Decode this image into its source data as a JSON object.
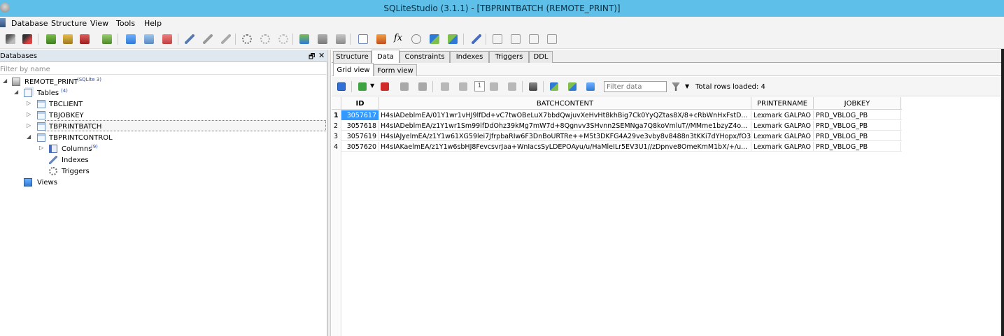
{
  "window": {
    "title": "SQLiteStudio (3.1.1) - [TBPRINTBATCH (REMOTE_PRINT)]"
  },
  "menu": [
    "Database",
    "Structure",
    "View",
    "Tools",
    "Help"
  ],
  "databases_panel": {
    "title": "Databases",
    "float_glyph": "🗗",
    "close_glyph": "✕",
    "filter_placeholder": "Filter by name",
    "database": {
      "name": "REMOTE_PRINT",
      "version": "(SQLite 3)"
    },
    "tables_group": {
      "label": "Tables",
      "count": "(4)"
    },
    "tables": [
      "TBCLIENT",
      "TBJOBKEY",
      "TBPRINTBATCH",
      "TBPRINTCONTROL"
    ],
    "columns_node": {
      "label": "Columns",
      "count": "(9)"
    },
    "indexes_label": "Indexes",
    "triggers_label": "Triggers",
    "views_label": "Views"
  },
  "tabs": [
    "Structure",
    "Data",
    "Constraints",
    "Indexes",
    "Triggers",
    "DDL"
  ],
  "active_tab": "Data",
  "subtabs": [
    "Grid view",
    "Form view"
  ],
  "grid_toolbar": {
    "page_number": "1",
    "filter_placeholder": "Filter data",
    "total_rows": "Total rows loaded: 4"
  },
  "grid": {
    "columns": [
      "ID",
      "BATCHCONTENT",
      "PRINTERNAME",
      "JOBKEY"
    ],
    "rows": [
      {
        "num": "1",
        "id": "3057617",
        "batch": "H4sIADeblmEA/01Y1wr1vHJ9lfDd+vC7twOBeLuX7bbdQwjuvXeHvHt8khBig7Ck0YyQZtas8X/8+cRbWnHxFstD...",
        "printer": "Lexmark GALPAO",
        "job": "PRD_VBLOG_PB"
      },
      {
        "num": "2",
        "id": "3057618",
        "batch": "H4sIADeblmEA/z1Y1wr1Sm99lfDdOhz39kMg7mW7d+8Qgnvv3SHvnn2SEMNga7Q8koVmluT//MMme1bzyZ4o...",
        "printer": "Lexmark GALPAO",
        "job": "PRD_VBLOG_PB"
      },
      {
        "num": "3",
        "id": "3057619",
        "batch": "H4sIAJyelmEA/z1Y1w61XG59lei7JfrpbaRIw6F3DnBoURTRe++M5t3DKFG4A29ve3vby8v8488n3tKKi7dYHopx/fO3...",
        "printer": "Lexmark GALPAO",
        "job": "PRD_VBLOG_PB"
      },
      {
        "num": "4",
        "id": "3057620",
        "batch": "H4sIAKaelmEA/z1Y1w6sbHJ8FevcsvrJaa+WnIacsSyLDEPOAyu/u/HaMleILr5EV3U1//zDpnve8OmeKmM1bX/+/u...",
        "printer": "Lexmark GALPAO",
        "job": "PRD_VBLOG_PB"
      }
    ]
  }
}
